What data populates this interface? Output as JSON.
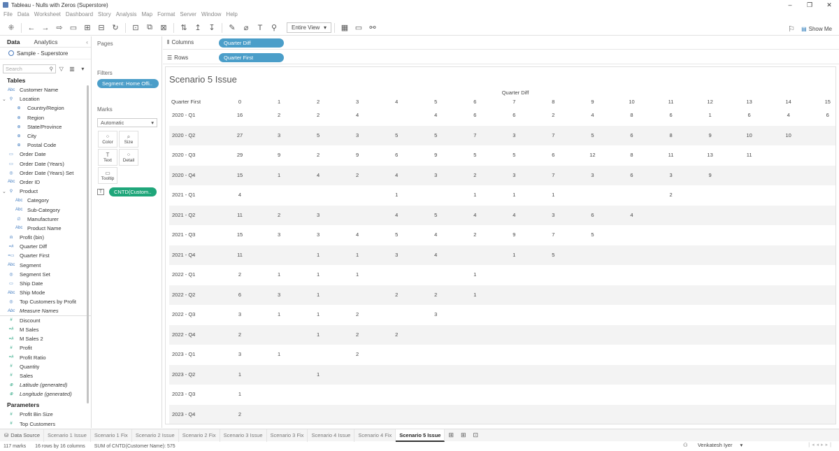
{
  "window": {
    "title": "Tableau - Nulls with Zeros (Superstore)"
  },
  "menu": [
    "File",
    "Data",
    "Worksheet",
    "Dashboard",
    "Story",
    "Analysis",
    "Map",
    "Format",
    "Server",
    "Window",
    "Help"
  ],
  "toolbar": {
    "fit_value": "Entire View",
    "show_me": "Show Me"
  },
  "left_panel": {
    "tab_data": "Data",
    "tab_analytics": "Analytics",
    "datasource": "Sample - Superstore",
    "search_placeholder": "Search",
    "tables_header": "Tables",
    "parameters_header": "Parameters",
    "fields": [
      {
        "label": "Customer Name",
        "type": "dim",
        "icon": "Abc",
        "level": 1
      },
      {
        "label": "Location",
        "type": "dim",
        "icon": "⚲",
        "level": 1
      },
      {
        "label": "Country/Region",
        "type": "dim",
        "icon": "⊕",
        "level": 2
      },
      {
        "label": "Region",
        "type": "dim",
        "icon": "⊕",
        "level": 2
      },
      {
        "label": "State/Province",
        "type": "dim",
        "icon": "⊕",
        "level": 2
      },
      {
        "label": "City",
        "type": "dim",
        "icon": "⊕",
        "level": 2
      },
      {
        "label": "Postal Code",
        "type": "dim",
        "icon": "⊕",
        "level": 2
      },
      {
        "label": "Order Date",
        "type": "dim",
        "icon": "▭",
        "level": 1
      },
      {
        "label": "Order Date (Years)",
        "type": "dim",
        "icon": "▭",
        "level": 1
      },
      {
        "label": "Order Date (Years) Set",
        "type": "dim",
        "icon": "◎",
        "level": 1
      },
      {
        "label": "Order ID",
        "type": "dim",
        "icon": "Abc",
        "level": 1
      },
      {
        "label": "Product",
        "type": "dim",
        "icon": "⚲",
        "level": 1
      },
      {
        "label": "Category",
        "type": "dim",
        "icon": "Abc",
        "level": 2
      },
      {
        "label": "Sub-Category",
        "type": "dim",
        "icon": "Abc",
        "level": 2
      },
      {
        "label": "Manufacturer",
        "type": "dim",
        "icon": "∅",
        "level": 2
      },
      {
        "label": "Product Name",
        "type": "dim",
        "icon": "Abc",
        "level": 2
      },
      {
        "label": "Profit (bin)",
        "type": "dim",
        "icon": "ılı",
        "level": 1
      },
      {
        "label": "Quarter Diff",
        "type": "dim",
        "icon": "=#",
        "level": 1
      },
      {
        "label": "Quarter First",
        "type": "dim",
        "icon": "=▭",
        "level": 1
      },
      {
        "label": "Segment",
        "type": "dim",
        "icon": "Abc",
        "level": 1
      },
      {
        "label": "Segment Set",
        "type": "dim",
        "icon": "◎",
        "level": 1
      },
      {
        "label": "Ship Date",
        "type": "dim",
        "icon": "▭",
        "level": 1
      },
      {
        "label": "Ship Mode",
        "type": "dim",
        "icon": "Abc",
        "level": 1
      },
      {
        "label": "Top Customers by Profit",
        "type": "dim",
        "icon": "◎",
        "level": 1
      },
      {
        "label": "Measure Names",
        "type": "dim",
        "icon": "Abc",
        "level": 1,
        "italic": true
      },
      {
        "label": "Discount",
        "type": "mea",
        "icon": "#",
        "level": 1
      },
      {
        "label": "M Sales",
        "type": "mea",
        "icon": "=#",
        "level": 1
      },
      {
        "label": "M Sales 2",
        "type": "mea",
        "icon": "=#",
        "level": 1
      },
      {
        "label": "Profit",
        "type": "mea",
        "icon": "#",
        "level": 1
      },
      {
        "label": "Profit Ratio",
        "type": "mea",
        "icon": "=#",
        "level": 1
      },
      {
        "label": "Quantity",
        "type": "mea",
        "icon": "#",
        "level": 1
      },
      {
        "label": "Sales",
        "type": "mea",
        "icon": "#",
        "level": 1
      },
      {
        "label": "Latitude (generated)",
        "type": "mea",
        "icon": "⊕",
        "level": 1,
        "italic": true
      },
      {
        "label": "Longitude (generated)",
        "type": "mea",
        "icon": "⊕",
        "level": 1,
        "italic": true
      }
    ],
    "parameters": [
      {
        "label": "Profit Bin Size",
        "icon": "#"
      },
      {
        "label": "Top Customers",
        "icon": "#"
      }
    ]
  },
  "cards": {
    "pages": "Pages",
    "filters": "Filters",
    "filter_pill": "Segment: Home Offi..",
    "marks": "Marks",
    "mark_type": "Automatic",
    "mark_buttons": [
      {
        "label": "Color",
        "icon": "⁘"
      },
      {
        "label": "Size",
        "icon": "⌕"
      },
      {
        "label": "Text",
        "icon": "T"
      },
      {
        "label": "Detail",
        "icon": "⁘"
      },
      {
        "label": "Tooltip",
        "icon": "▭"
      }
    ],
    "mark_pill": "CNTD(Custom.."
  },
  "shelves": {
    "columns_label": "Columns",
    "columns_pill": "Quarter Diff",
    "rows_label": "Rows",
    "rows_pill": "Quarter First"
  },
  "view": {
    "title": "Scenario 5 Issue",
    "column_field": "Quarter Diff",
    "row_field": "Quarter First",
    "columns": [
      "0",
      "1",
      "2",
      "3",
      "4",
      "5",
      "6",
      "7",
      "8",
      "9",
      "10",
      "11",
      "12",
      "13",
      "14",
      "15"
    ],
    "rows": [
      {
        "label": "2020 - Q1",
        "values": [
          "16",
          "2",
          "2",
          "4",
          "",
          "4",
          "6",
          "6",
          "2",
          "4",
          "8",
          "6",
          "1",
          "6",
          "4",
          "6"
        ]
      },
      {
        "label": "2020 - Q2",
        "values": [
          "27",
          "3",
          "5",
          "3",
          "5",
          "5",
          "7",
          "3",
          "7",
          "5",
          "6",
          "8",
          "9",
          "10",
          "10",
          ""
        ]
      },
      {
        "label": "2020 - Q3",
        "values": [
          "29",
          "9",
          "2",
          "9",
          "6",
          "9",
          "5",
          "5",
          "6",
          "12",
          "8",
          "11",
          "13",
          "11",
          "",
          ""
        ]
      },
      {
        "label": "2020 - Q4",
        "values": [
          "15",
          "1",
          "4",
          "2",
          "4",
          "3",
          "2",
          "3",
          "7",
          "3",
          "6",
          "3",
          "9",
          "",
          "",
          ""
        ]
      },
      {
        "label": "2021 - Q1",
        "values": [
          "4",
          "",
          "",
          "",
          "1",
          "",
          "1",
          "1",
          "1",
          "",
          "",
          "2",
          "",
          "",
          "",
          ""
        ]
      },
      {
        "label": "2021 - Q2",
        "values": [
          "11",
          "2",
          "3",
          "",
          "4",
          "5",
          "4",
          "4",
          "3",
          "6",
          "4",
          "",
          "",
          "",
          "",
          ""
        ]
      },
      {
        "label": "2021 - Q3",
        "values": [
          "15",
          "3",
          "3",
          "4",
          "5",
          "4",
          "2",
          "9",
          "7",
          "5",
          "",
          "",
          "",
          "",
          "",
          ""
        ]
      },
      {
        "label": "2021 - Q4",
        "values": [
          "11",
          "",
          "1",
          "1",
          "3",
          "4",
          "",
          "1",
          "5",
          "",
          "",
          "",
          "",
          "",
          "",
          ""
        ]
      },
      {
        "label": "2022 - Q1",
        "values": [
          "2",
          "1",
          "1",
          "1",
          "",
          "",
          "1",
          "",
          "",
          "",
          "",
          "",
          "",
          "",
          "",
          ""
        ]
      },
      {
        "label": "2022 - Q2",
        "values": [
          "6",
          "3",
          "1",
          "",
          "2",
          "2",
          "1",
          "",
          "",
          "",
          "",
          "",
          "",
          "",
          "",
          ""
        ]
      },
      {
        "label": "2022 - Q3",
        "values": [
          "3",
          "1",
          "1",
          "2",
          "",
          "3",
          "",
          "",
          "",
          "",
          "",
          "",
          "",
          "",
          "",
          ""
        ]
      },
      {
        "label": "2022 - Q4",
        "values": [
          "2",
          "",
          "1",
          "2",
          "2",
          "",
          "",
          "",
          "",
          "",
          "",
          "",
          "",
          "",
          "",
          ""
        ]
      },
      {
        "label": "2023 - Q1",
        "values": [
          "3",
          "1",
          "",
          "2",
          "",
          "",
          "",
          "",
          "",
          "",
          "",
          "",
          "",
          "",
          "",
          ""
        ]
      },
      {
        "label": "2023 - Q2",
        "values": [
          "1",
          "",
          "1",
          "",
          "",
          "",
          "",
          "",
          "",
          "",
          "",
          "",
          "",
          "",
          "",
          ""
        ]
      },
      {
        "label": "2023 - Q3",
        "values": [
          "1",
          "",
          "",
          "",
          "",
          "",
          "",
          "",
          "",
          "",
          "",
          "",
          "",
          "",
          "",
          ""
        ]
      },
      {
        "label": "2023 - Q4",
        "values": [
          "2",
          "",
          "",
          "",
          "",
          "",
          "",
          "",
          "",
          "",
          "",
          "",
          "",
          "",
          "",
          ""
        ]
      }
    ]
  },
  "sheet_tabs": {
    "data_source": "Data Source",
    "tabs": [
      "Scenario 1 Issue",
      "Scenario 1 Fix",
      "Scenario 2 Issue",
      "Scenario 2 Fix",
      "Scenario 3 Issue",
      "Scenario 3 Fix",
      "Scenario 4 Issue",
      "Scenario 4 Fix",
      "Scenario 5 Issue"
    ],
    "active": "Scenario 5 Issue"
  },
  "status": {
    "marks": "117 marks",
    "dims": "16 rows by 16 columns",
    "sum": "SUM of CNTD(Customer Name): 575",
    "user": "Venkatesh Iyer"
  }
}
